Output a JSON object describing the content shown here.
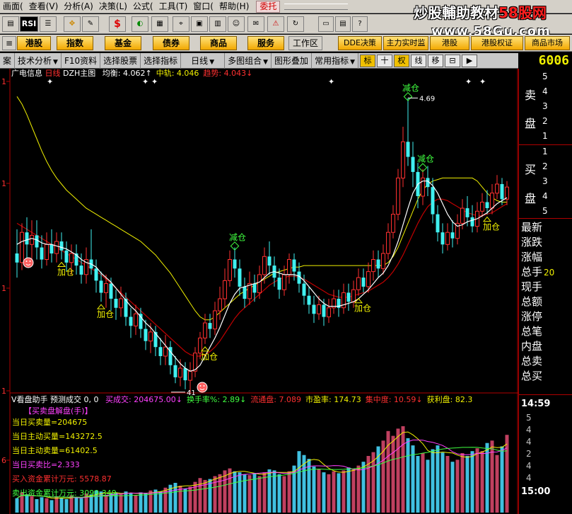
{
  "menubar": {
    "items": [
      "画面(",
      "查看(V)",
      "分析(A)",
      "决策(L)",
      "公式(",
      "工具(T)",
      "窗口(",
      "帮助(H)"
    ],
    "entrust_label": "委托"
  },
  "watermark": {
    "brand": "炒股輔助教材",
    "brand_red": "58股网",
    "url": "www.58Gu.com"
  },
  "toolbar": {
    "rsi_label": "RSI"
  },
  "quickbar": {
    "buttons": [
      "港股",
      "指数",
      "基金",
      "债券",
      "商品",
      "服务"
    ],
    "workarea_label": "工作区",
    "right_buttons": [
      "DDE决策",
      "主力实时监",
      "港股",
      "港股权证",
      "商品市场"
    ]
  },
  "funcbar": {
    "tabs": [
      "案",
      "技术分析",
      "F10资料",
      "选择股票",
      "选择指标",
      "日线",
      "多图组合",
      "图形叠加",
      "常用指标"
    ],
    "icons": [
      "标",
      "十",
      "权",
      "线",
      "移",
      "⊟",
      "▶"
    ],
    "stock_code": "6006"
  },
  "main_legend": {
    "stock_name": "广电信息",
    "period": "日线",
    "indicator": "DZH主图",
    "items": [
      {
        "label": "均衡",
        "value": "4.062",
        "arrow": "↑",
        "color": "#ffffff"
      },
      {
        "label": "中轨",
        "value": "4.046",
        "arrow": "",
        "color": "#f0f000"
      },
      {
        "label": "趋势",
        "value": "4.043",
        "arrow": "↓",
        "color": "#ff3030"
      }
    ]
  },
  "volume_legend": {
    "name": "V看盘助手",
    "pred_label": "预测成交",
    "pred_value": "0, 0",
    "items": [
      {
        "label": "买成交",
        "value": "204675.00",
        "arrow": "↓",
        "color": "#ff40ff"
      },
      {
        "label": "换手率%",
        "value": "2.89",
        "arrow": "↓",
        "color": "#40ff40"
      },
      {
        "label": "流通盘",
        "value": "7.089",
        "arrow": "",
        "color": "#ff3030"
      },
      {
        "label": "市盈率",
        "value": "174.73",
        "arrow": "",
        "color": "#f0f000"
      },
      {
        "label": "集中度",
        "value": "10.59",
        "arrow": "↓",
        "color": "#ff3030"
      },
      {
        "label": "获利盘",
        "value": "82.3",
        "arrow": "",
        "color": "#f0f000"
      }
    ],
    "title": "【买卖盘解盘(手)】",
    "stats": [
      {
        "text": "当日买卖量=204675",
        "color": "#f0f000"
      },
      {
        "text": "当日主动买量=143272.5",
        "color": "#f0f000"
      },
      {
        "text": "当日主动卖量=61402.5",
        "color": "#f0f000"
      },
      {
        "text": "当日买卖比=2.333",
        "color": "#ff40ff"
      },
      {
        "text": "买入资金累计万元: 5578.87",
        "color": "#ff3030"
      },
      {
        "text": "卖出资金累计万元: 3099.349",
        "color": "#40ff40"
      }
    ]
  },
  "annotations": {
    "add_labels": [
      "加仓",
      "加仓",
      "加仓",
      "加仓",
      "加仓"
    ],
    "reduce_labels": [
      "减仓",
      "减仓",
      "减仓"
    ],
    "high_label": "4.69",
    "low_label": "41"
  },
  "left_ticks": [
    "1",
    "1",
    "1",
    "1",
    "6"
  ],
  "right_panel": {
    "sell_label": [
      "卖",
      "盘"
    ],
    "sell_nums": [
      "5",
      "4",
      "3",
      "2",
      "1"
    ],
    "buy_label": [
      "买",
      "盘"
    ],
    "buy_nums": [
      "1",
      "2",
      "3",
      "4",
      "5"
    ],
    "quote_rows": [
      "最新",
      "涨跌",
      "涨幅",
      "总手",
      "现手",
      "总额",
      "涨停",
      "总笔",
      "内盘",
      "总卖",
      "总买"
    ],
    "zongshou_value": "20",
    "times": [
      "14:59",
      "15:00"
    ],
    "tick_rows": [
      "5",
      "4",
      "4",
      "2",
      "4",
      "4"
    ]
  },
  "colors": {
    "up": "#ff3030",
    "down": "#40f0f0",
    "ma_white": "#ffffff",
    "ma_yellow": "#f0f000",
    "ma_red": "#c00000",
    "frame": "#b00000"
  },
  "chart_data": {
    "type": "candlestick",
    "candles": [
      [
        3.66,
        3.6,
        3.82,
        3.5
      ],
      [
        3.6,
        3.8,
        3.86,
        3.55
      ],
      [
        3.8,
        3.72,
        3.9,
        3.62
      ],
      [
        3.72,
        3.78,
        3.88,
        3.6
      ],
      [
        3.78,
        3.7,
        3.88,
        3.62
      ],
      [
        3.7,
        3.62,
        3.78,
        3.56
      ],
      [
        3.62,
        3.72,
        3.8,
        3.58
      ],
      [
        3.72,
        3.66,
        3.82,
        3.6
      ],
      [
        3.66,
        3.74,
        3.8,
        3.6
      ],
      [
        3.74,
        3.68,
        3.8,
        3.62
      ],
      [
        3.68,
        3.6,
        3.74,
        3.54
      ],
      [
        3.6,
        3.66,
        3.72,
        3.52
      ],
      [
        3.66,
        3.58,
        3.72,
        3.52
      ],
      [
        3.58,
        3.52,
        3.66,
        3.46
      ],
      [
        3.52,
        3.62,
        3.7,
        3.46
      ],
      [
        3.62,
        3.56,
        3.82,
        3.52
      ],
      [
        3.56,
        3.48,
        3.62,
        3.4
      ],
      [
        3.48,
        3.4,
        3.54,
        3.34
      ],
      [
        3.4,
        3.46,
        3.52,
        3.3
      ],
      [
        3.46,
        3.36,
        3.5,
        3.28
      ],
      [
        3.36,
        3.3,
        3.42,
        3.22
      ],
      [
        3.3,
        3.36,
        3.44,
        3.24
      ],
      [
        3.36,
        3.24,
        3.4,
        3.18
      ],
      [
        3.24,
        3.18,
        3.3,
        3.1
      ],
      [
        3.18,
        3.26,
        3.32,
        3.12
      ],
      [
        3.26,
        3.16,
        3.3,
        3.1
      ],
      [
        3.16,
        3.08,
        3.22,
        3.02
      ],
      [
        3.08,
        3.14,
        3.2,
        3.0
      ],
      [
        3.14,
        3.04,
        3.18,
        2.98
      ],
      [
        3.04,
        2.98,
        3.1,
        2.92
      ],
      [
        2.98,
        3.04,
        3.12,
        2.92
      ],
      [
        3.04,
        2.92,
        3.08,
        2.86
      ],
      [
        2.92,
        2.84,
        2.98,
        2.8
      ],
      [
        2.84,
        2.9,
        2.96,
        2.78
      ],
      [
        2.9,
        2.82,
        2.94,
        2.76
      ],
      [
        2.82,
        2.88,
        2.94,
        2.74
      ],
      [
        2.88,
        3.0,
        3.04,
        2.84
      ],
      [
        3.0,
        3.1,
        3.14,
        2.96
      ],
      [
        3.1,
        3.2,
        3.26,
        3.06
      ],
      [
        3.2,
        3.16,
        3.26,
        3.1
      ],
      [
        3.16,
        3.28,
        3.34,
        3.12
      ],
      [
        3.28,
        3.36,
        3.44,
        3.22
      ],
      [
        3.36,
        3.48,
        3.56,
        3.3
      ],
      [
        3.48,
        3.62,
        3.68,
        3.44
      ],
      [
        3.62,
        3.56,
        3.7,
        3.5
      ],
      [
        3.56,
        3.44,
        3.62,
        3.38
      ],
      [
        3.44,
        3.36,
        3.5,
        3.3
      ],
      [
        3.36,
        3.46,
        3.54,
        3.32
      ],
      [
        3.46,
        3.4,
        3.52,
        3.34
      ],
      [
        3.4,
        3.52,
        3.58,
        3.36
      ],
      [
        3.52,
        3.64,
        3.7,
        3.46
      ],
      [
        3.64,
        3.58,
        3.74,
        3.52
      ],
      [
        3.58,
        3.5,
        3.64,
        3.44
      ],
      [
        3.5,
        3.42,
        3.56,
        3.36
      ],
      [
        3.42,
        3.52,
        3.58,
        3.38
      ],
      [
        3.52,
        3.62,
        3.66,
        3.46
      ],
      [
        3.62,
        3.54,
        3.66,
        3.48
      ],
      [
        3.54,
        3.46,
        3.6,
        3.4
      ],
      [
        3.46,
        3.38,
        3.52,
        3.32
      ],
      [
        3.38,
        3.32,
        3.44,
        3.26
      ],
      [
        3.32,
        3.26,
        3.38,
        3.2
      ],
      [
        3.26,
        3.32,
        3.38,
        3.22
      ],
      [
        3.32,
        3.24,
        3.36,
        3.18
      ],
      [
        3.24,
        3.3,
        3.36,
        3.2
      ],
      [
        3.3,
        3.36,
        3.42,
        3.26
      ],
      [
        3.36,
        3.3,
        3.42,
        3.24
      ],
      [
        3.3,
        3.4,
        3.46,
        3.26
      ],
      [
        3.4,
        3.34,
        3.46,
        3.28
      ],
      [
        3.34,
        3.42,
        3.48,
        3.3
      ],
      [
        3.42,
        3.5,
        3.56,
        3.38
      ],
      [
        3.5,
        3.44,
        3.56,
        3.4
      ],
      [
        3.44,
        3.54,
        3.6,
        3.4
      ],
      [
        3.54,
        3.62,
        3.68,
        3.48
      ],
      [
        3.62,
        3.56,
        3.68,
        3.5
      ],
      [
        3.56,
        3.66,
        3.72,
        3.52
      ],
      [
        3.66,
        3.8,
        3.86,
        3.62
      ],
      [
        3.8,
        3.92,
        3.98,
        3.76
      ],
      [
        3.92,
        4.16,
        4.22,
        3.88
      ],
      [
        4.16,
        4.4,
        4.5,
        4.1
      ],
      [
        4.4,
        4.3,
        4.69,
        4.24
      ],
      [
        4.3,
        4.2,
        4.4,
        4.1
      ],
      [
        4.2,
        4.04,
        4.26,
        3.96
      ],
      [
        4.04,
        4.16,
        4.22,
        3.98
      ],
      [
        4.16,
        4.1,
        4.24,
        4.04
      ],
      [
        4.1,
        3.92,
        4.16,
        3.86
      ],
      [
        3.92,
        3.8,
        3.98,
        3.74
      ],
      [
        3.8,
        3.72,
        3.86,
        3.66
      ],
      [
        3.72,
        3.8,
        3.86,
        3.68
      ],
      [
        3.8,
        3.76,
        3.88,
        3.7
      ],
      [
        3.76,
        3.86,
        3.92,
        3.72
      ],
      [
        3.86,
        3.96,
        4.02,
        3.82
      ],
      [
        3.96,
        3.9,
        4.04,
        3.84
      ],
      [
        3.9,
        3.84,
        3.98,
        3.8
      ],
      [
        3.84,
        3.94,
        4.0,
        3.8
      ],
      [
        3.94,
        4.0,
        4.06,
        3.9
      ],
      [
        4.0,
        3.96,
        4.08,
        3.92
      ],
      [
        3.96,
        4.06,
        4.12,
        3.92
      ],
      [
        4.06,
        4.12,
        4.18,
        4.02
      ],
      [
        4.12,
        4.02,
        4.16,
        3.98
      ],
      [
        4.02,
        4.1,
        4.14,
        3.98
      ]
    ],
    "ma_white": [
      3.72,
      3.74,
      3.75,
      3.76,
      3.75,
      3.73,
      3.72,
      3.72,
      3.71,
      3.7,
      3.69,
      3.67,
      3.65,
      3.62,
      3.6,
      3.59,
      3.57,
      3.53,
      3.5,
      3.47,
      3.43,
      3.39,
      3.35,
      3.31,
      3.28,
      3.24,
      3.2,
      3.17,
      3.13,
      3.09,
      3.05,
      3.01,
      2.97,
      2.93,
      2.9,
      2.88,
      2.89,
      2.92,
      2.98,
      3.04,
      3.1,
      3.17,
      3.25,
      3.33,
      3.39,
      3.43,
      3.44,
      3.45,
      3.46,
      3.47,
      3.5,
      3.53,
      3.54,
      3.53,
      3.52,
      3.52,
      3.52,
      3.51,
      3.48,
      3.44,
      3.4,
      3.36,
      3.33,
      3.31,
      3.31,
      3.31,
      3.32,
      3.33,
      3.34,
      3.36,
      3.39,
      3.42,
      3.46,
      3.5,
      3.53,
      3.58,
      3.65,
      3.74,
      3.85,
      3.96,
      4.06,
      4.12,
      4.14,
      4.14,
      4.11,
      4.06,
      3.99,
      3.92,
      3.87,
      3.84,
      3.85,
      3.87,
      3.88,
      3.89,
      3.91,
      3.93,
      3.96,
      3.99,
      4.01,
      4.03
    ],
    "ma_red": [
      3.86,
      3.84,
      3.82,
      3.8,
      3.78,
      3.76,
      3.74,
      3.72,
      3.7,
      3.68,
      3.66,
      3.64,
      3.62,
      3.6,
      3.58,
      3.56,
      3.54,
      3.52,
      3.49,
      3.46,
      3.43,
      3.4,
      3.37,
      3.34,
      3.31,
      3.28,
      3.25,
      3.22,
      3.19,
      3.16,
      3.13,
      3.1,
      3.07,
      3.04,
      3.01,
      2.99,
      2.98,
      2.98,
      2.99,
      3.01,
      3.04,
      3.08,
      3.13,
      3.18,
      3.23,
      3.27,
      3.3,
      3.33,
      3.36,
      3.39,
      3.42,
      3.45,
      3.47,
      3.49,
      3.5,
      3.51,
      3.51,
      3.5,
      3.49,
      3.47,
      3.45,
      3.43,
      3.41,
      3.39,
      3.38,
      3.37,
      3.37,
      3.37,
      3.38,
      3.39,
      3.4,
      3.41,
      3.43,
      3.45,
      3.47,
      3.5,
      3.54,
      3.59,
      3.65,
      3.72,
      3.79,
      3.86,
      3.92,
      3.97,
      4.0,
      4.02,
      4.02,
      4.01,
      3.99,
      3.97,
      3.95,
      3.93,
      3.92,
      3.91,
      3.91,
      3.92,
      3.93,
      3.95,
      3.97,
      3.99
    ],
    "ma_yellow": [
      4.7,
      4.65,
      4.58,
      4.5,
      4.42,
      4.34,
      4.27,
      4.21,
      4.16,
      4.12,
      4.08,
      4.05,
      4.02,
      3.99,
      3.96,
      3.94,
      3.92,
      3.9,
      3.88,
      3.86,
      3.84,
      3.82,
      3.8,
      3.78,
      3.76,
      3.74,
      3.71,
      3.68,
      3.65,
      3.61,
      3.57,
      3.53,
      3.48,
      3.43,
      3.38,
      3.33,
      3.28,
      3.24,
      3.22,
      3.22,
      3.24,
      3.27,
      3.3,
      3.33,
      3.36,
      3.39,
      3.41,
      3.43,
      3.45,
      3.47,
      3.49,
      3.51,
      3.53,
      3.54,
      3.55,
      3.56,
      3.57,
      3.57,
      3.58,
      3.58,
      3.58,
      3.58,
      3.58,
      3.58,
      3.58,
      3.58,
      3.58,
      3.58,
      3.58,
      3.58,
      3.58,
      3.58,
      3.58,
      3.58,
      3.58,
      3.6,
      3.64,
      3.7,
      3.78,
      3.86,
      3.94,
      4.02,
      4.08,
      4.12,
      4.14,
      4.15,
      4.16,
      4.16,
      4.16,
      4.16,
      4.16,
      4.16,
      4.16,
      4.14,
      4.1,
      4.06,
      4.03,
      4.01,
      4.0,
      4.0
    ],
    "volume": [
      30,
      42,
      38,
      35,
      28,
      32,
      30,
      26,
      34,
      30,
      28,
      36,
      32,
      30,
      40,
      38,
      46,
      44,
      36,
      40,
      42,
      38,
      44,
      40,
      36,
      42,
      40,
      46,
      48,
      44,
      52,
      58,
      62,
      56,
      50,
      54,
      64,
      72,
      68,
      70,
      76,
      80,
      88,
      92,
      86,
      84,
      80,
      78,
      82,
      76,
      84,
      90,
      88,
      80,
      76,
      86,
      98,
      128,
      120,
      112,
      96,
      90,
      84,
      80,
      86,
      82,
      88,
      94,
      90,
      98,
      106,
      118,
      126,
      138,
      150,
      170,
      160,
      175,
      180,
      155,
      140,
      118,
      124,
      110,
      132,
      140,
      125,
      118,
      106,
      110,
      124,
      118,
      128,
      134,
      128,
      145,
      150,
      120,
      138,
      162
    ]
  }
}
